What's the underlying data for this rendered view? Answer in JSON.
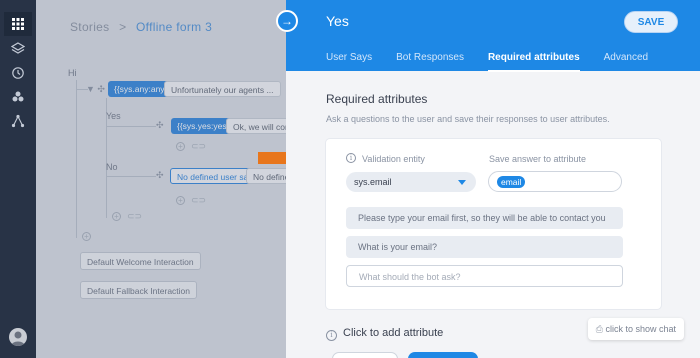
{
  "nav": {
    "items": [
      "grid-icon",
      "layers-icon",
      "history-icon",
      "people-icon",
      "flow-icon"
    ]
  },
  "canvas": {
    "breadcrumb": {
      "root": "Stories",
      "separator": ">",
      "current": "Offline form 3"
    },
    "root_label": "Hi",
    "nodes": {
      "sys_any": "{{sys.any:any}}",
      "unfortunately": "Unfortunately our agents ...",
      "yes_label": "Yes",
      "sys_yes": "{{sys.yes:yes}}",
      "ok_contact": "Ok, we will contac",
      "no_label": "No",
      "no_user_says": "No defined user says",
      "no_defined": "No defined",
      "welcome": "Default Welcome Interaction",
      "fallback": "Default Fallback Interaction"
    }
  },
  "panel": {
    "title": "Yes",
    "save_label": "SAVE",
    "tabs": [
      {
        "label": "User Says",
        "active": false
      },
      {
        "label": "Bot Responses",
        "active": false
      },
      {
        "label": "Required attributes",
        "active": true
      },
      {
        "label": "Advanced",
        "active": false
      }
    ],
    "section_title": "Required attributes",
    "section_desc": "Ask a questions to the user and save their responses to user attributes.",
    "validation_label": "Validation entity",
    "validation_value": "sys.email",
    "save_answer_label": "Save answer to attribute",
    "attribute_tag": "email",
    "messages": [
      "Please type your email first, so they will be able to contact you later",
      "What is your email?"
    ],
    "bot_ask_placeholder": "What should the bot ask?",
    "add_attribute_label": "Click to add attribute",
    "chat_label": "click to show chat"
  },
  "colors": {
    "accent": "#1e88e5",
    "rail": "#283346",
    "annotation": "#e8761c"
  }
}
